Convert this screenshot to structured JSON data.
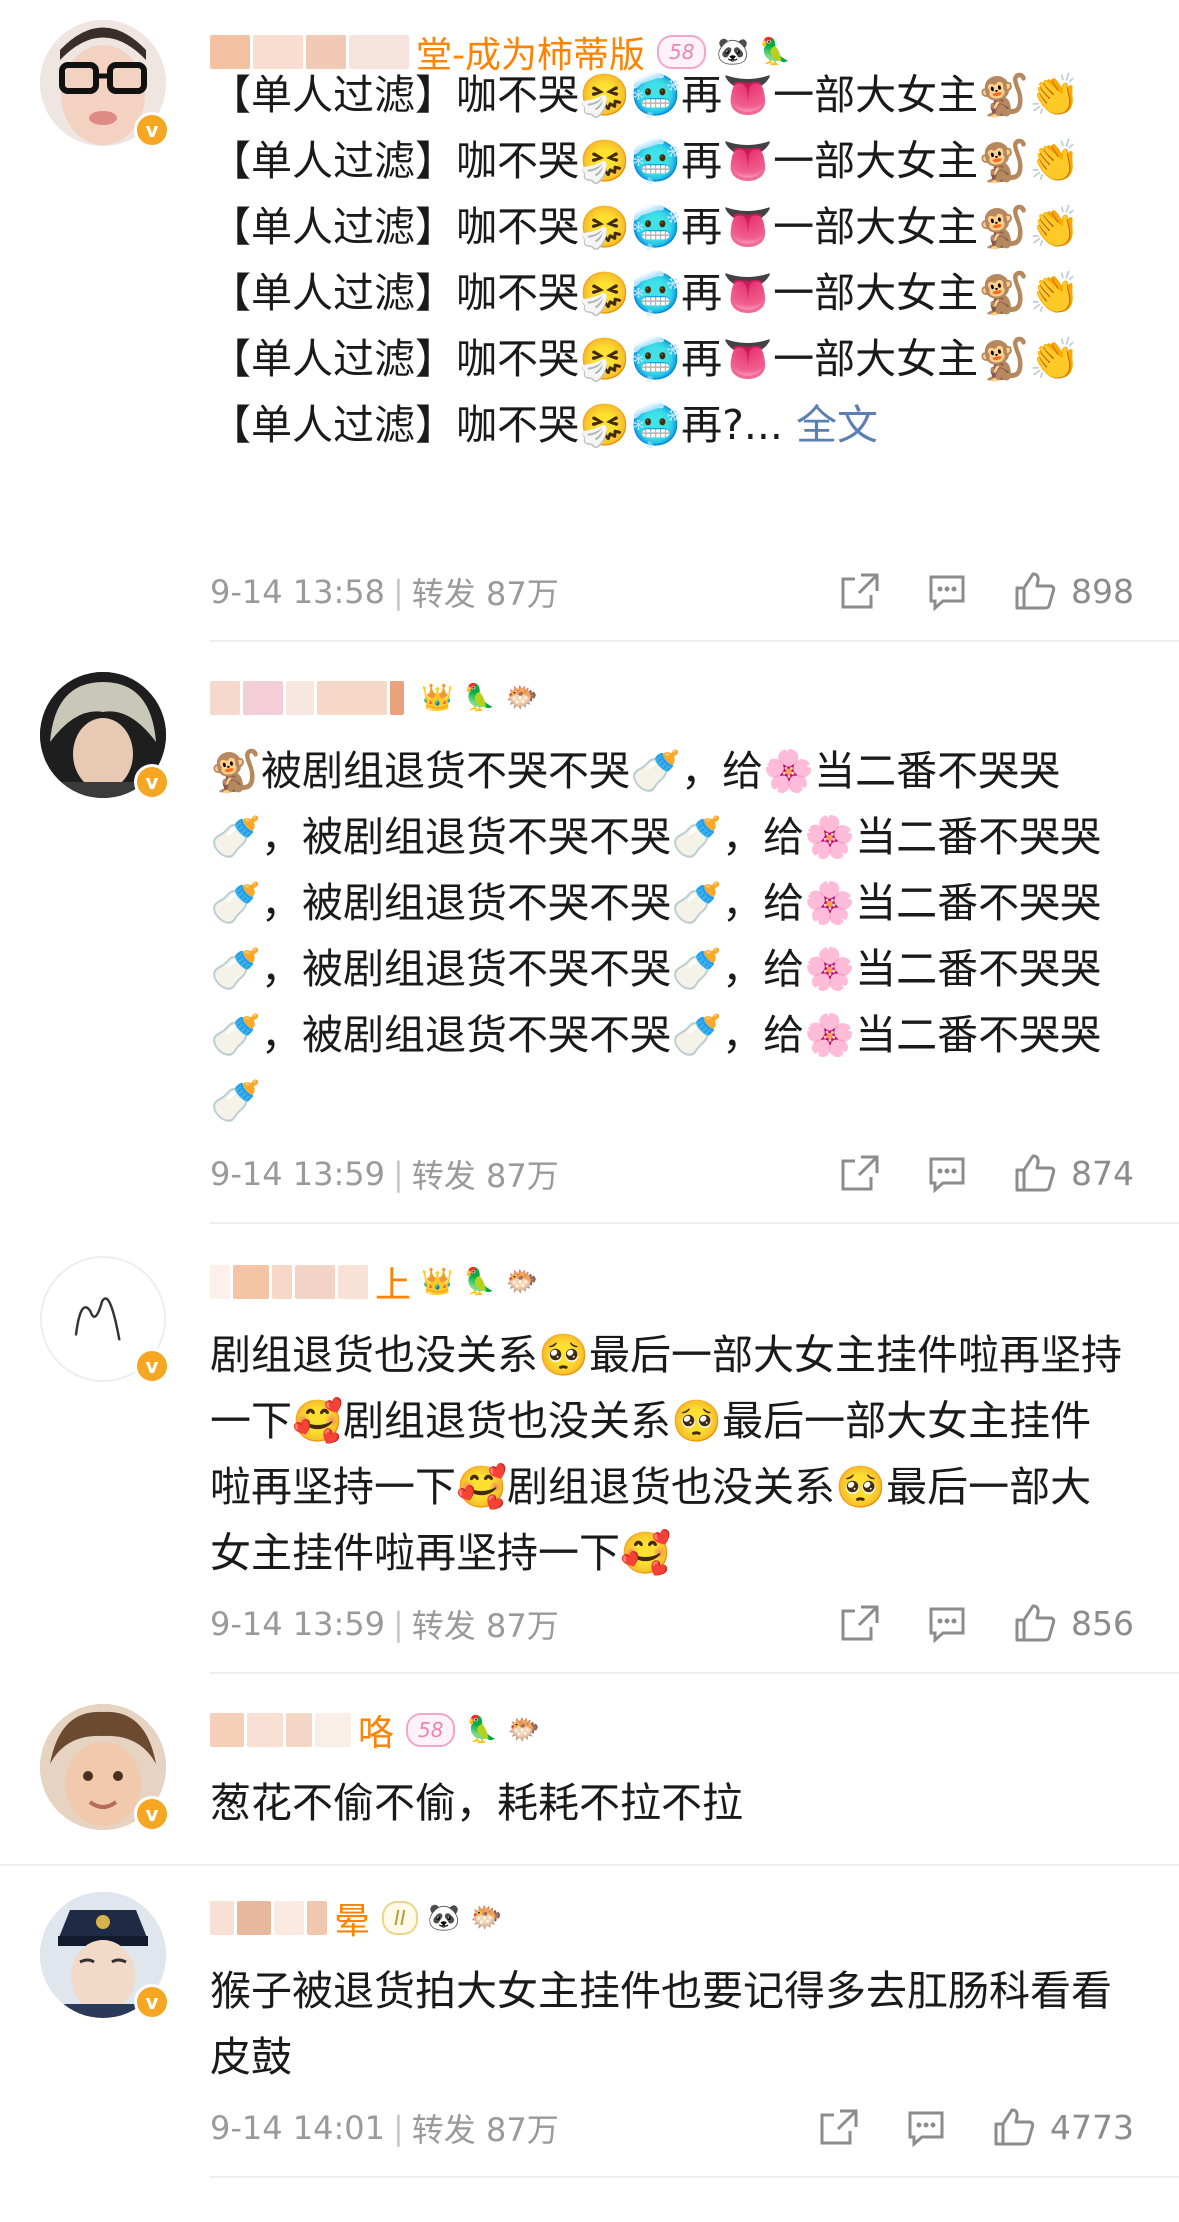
{
  "comments": [
    {
      "name": "堂-成为柿蒂版",
      "badge_level": "58",
      "content": "【单人过滤】咖不哭🤧🥶再👅一部大女主🐒👏【单人过滤】咖不哭🤧🥶再👅一部大女主🐒👏【单人过滤】咖不哭🤧🥶再👅一部大女主🐒👏【单人过滤】咖不哭🤧🥶再👅一部大女主🐒👏【单人过滤】咖不哭🤧🥶再👅一部大女主🐒👏【单人过滤】咖不哭🤧🥶再?...",
      "more": "全文",
      "time": "9-14 13:58",
      "repost": "转发 87万",
      "likes": "898"
    },
    {
      "name": "",
      "content": "🐒被剧组退货不哭不哭🍼，给🌸当二番不哭哭🍼，被剧组退货不哭不哭🍼，给🌸当二番不哭哭🍼，被剧组退货不哭不哭🍼，给🌸当二番不哭哭🍼，被剧组退货不哭不哭🍼，给🌸当二番不哭哭🍼，被剧组退货不哭不哭🍼，给🌸当二番不哭哭🍼",
      "time": "9-14 13:59",
      "repost": "转发 87万",
      "likes": "874"
    },
    {
      "name": "上",
      "content": "剧组退货也没关系🥺最后一部大女主挂件啦再坚持一下🥰剧组退货也没关系🥺最后一部大女主挂件啦再坚持一下🥰剧组退货也没关系🥺最后一部大女主挂件啦再坚持一下🥰",
      "time": "9-14 13:59",
      "repost": "转发 87万",
      "likes": "856"
    },
    {
      "name": "咯",
      "badge_level": "58",
      "content": "葱花不偷不偷，耗耗不拉不拉"
    },
    {
      "name": "晕",
      "badge_level": "II",
      "content": "猴子被退货拍大女主挂件也要记得多去肛肠科看看皮鼓",
      "time": "9-14 14:01",
      "repost": "转发 87万",
      "likes": "4773"
    }
  ],
  "icons": [
    "verified-v-icon",
    "share-icon",
    "comment-icon",
    "like-icon"
  ],
  "colors": {
    "name": "#ff8200",
    "meta": "#9a9a9a",
    "link": "#5b7fb2",
    "verified": "#f5a623"
  }
}
